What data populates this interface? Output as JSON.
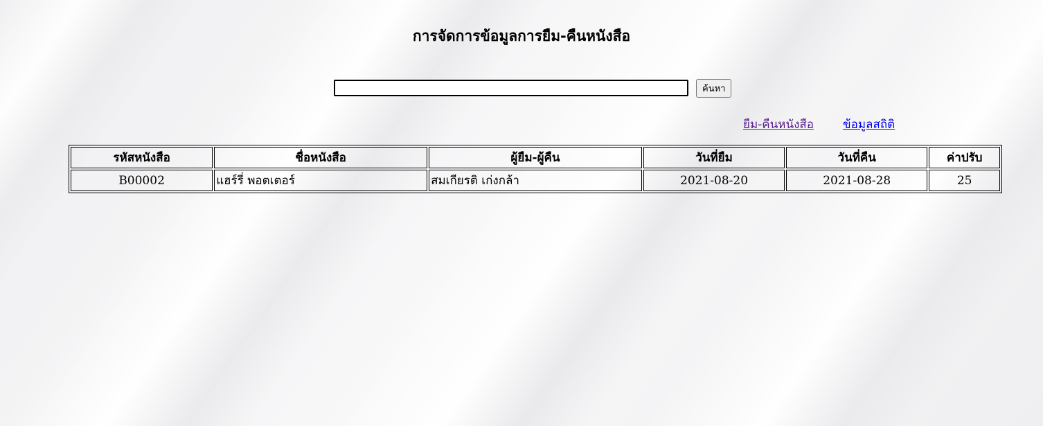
{
  "page": {
    "title": "การจัดการข้อมูลการยืม-คืนหนังสือ"
  },
  "search": {
    "value": "",
    "button_label": "ค้นหา"
  },
  "nav": {
    "borrow_return_link": "ยืม-คืนหนังสือ",
    "statistics_link": "ข้อมูลสถิติ"
  },
  "table": {
    "headers": [
      "รหัสหนังสือ",
      "ชื่อหนังสือ",
      "ผู้ยืม-ผู้คืน",
      "วันที่ยืม",
      "วันที่คืน",
      "ค่าปรับ"
    ],
    "rows": [
      [
        "B00002",
        "แฮร์รี่ พอตเตอร์",
        "สมเกียรติ เก่งกล้า",
        "2021-08-20",
        "2021-08-28",
        "25"
      ]
    ]
  },
  "colors": {
    "visited_link": "#551a8b",
    "link": "#0000ee",
    "border": "#000000"
  }
}
